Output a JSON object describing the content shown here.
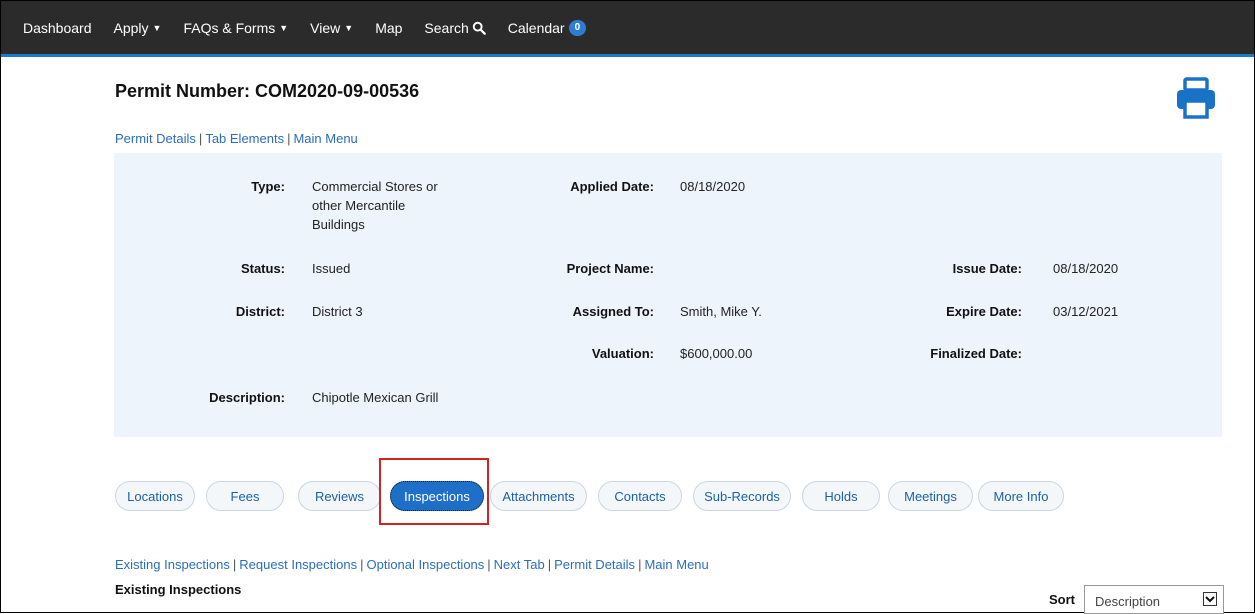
{
  "nav": {
    "dashboard": "Dashboard",
    "apply": "Apply",
    "faqs": "FAQs & Forms",
    "view": "View",
    "map": "Map",
    "search": "Search",
    "calendar": "Calendar",
    "calendar_count": "0"
  },
  "permit": {
    "title": "Permit Number: COM2020-09-00536"
  },
  "top_links": {
    "permit_details": "Permit Details",
    "tab_elements": "Tab Elements",
    "main_menu": "Main Menu"
  },
  "details": {
    "type_label": "Type:",
    "type_value_1": "Commercial Stores or",
    "type_value_2": "other Mercantile",
    "type_value_3": "Buildings",
    "applied_label": "Applied Date:",
    "applied_value": "08/18/2020",
    "status_label": "Status:",
    "status_value": "Issued",
    "project_label": "Project Name:",
    "issue_label": "Issue Date:",
    "issue_value": "08/18/2020",
    "district_label": "District:",
    "district_value": "District 3",
    "assigned_label": "Assigned To:",
    "assigned_value": "Smith, Mike Y.",
    "expire_label": "Expire Date:",
    "expire_value": "03/12/2021",
    "valuation_label": "Valuation:",
    "valuation_value": "$600,000.00",
    "finalized_label": "Finalized Date:",
    "description_label": "Description:",
    "description_value": "Chipotle Mexican Grill"
  },
  "tabs": {
    "locations": "Locations",
    "fees": "Fees",
    "reviews": "Reviews",
    "inspections": "Inspections",
    "attachments": "Attachments",
    "contacts": "Contacts",
    "sub_records": "Sub-Records",
    "holds": "Holds",
    "meetings": "Meetings",
    "more_info": "More Info"
  },
  "bottom_links": {
    "existing": "Existing Inspections",
    "request": "Request Inspections",
    "optional": "Optional Inspections",
    "next_tab": "Next Tab",
    "permit_details": "Permit Details",
    "main_menu": "Main Menu"
  },
  "section": {
    "heading": "Existing Inspections",
    "sort_label": "Sort",
    "sort_value": "Description"
  },
  "colors": {
    "nav_bg": "#2b2b2b",
    "accent": "#1f6fc8",
    "link": "#2a6ebb",
    "panel_bg": "#eef4fb",
    "highlight": "#d32222"
  },
  "icons": {
    "print": "print-icon",
    "search": "search-icon",
    "caret": "caret-down-icon"
  }
}
